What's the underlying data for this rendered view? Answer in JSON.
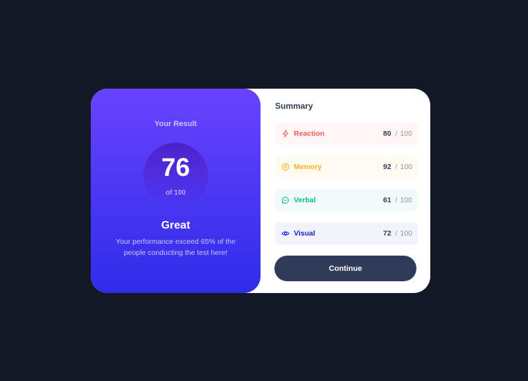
{
  "result": {
    "heading": "Your Result",
    "score": "76",
    "score_of": "of 100",
    "grade": "Great",
    "description": "Your performance exceed 65% of the people conducting the test here!"
  },
  "summary": {
    "title": "Summary",
    "items": [
      {
        "label": "Reaction",
        "score": "80",
        "separator": "/",
        "max": "100",
        "icon": "lightning-icon",
        "color": "#ff5757",
        "bg": "#fff6f5"
      },
      {
        "label": "Memory",
        "score": "92",
        "separator": "/",
        "max": "100",
        "icon": "brain-icon",
        "color": "#ffb01f",
        "bg": "#fffbf2"
      },
      {
        "label": "Verbal",
        "score": "61",
        "separator": "/",
        "max": "100",
        "icon": "chat-icon",
        "color": "#00bb8f",
        "bg": "#f2fbfa"
      },
      {
        "label": "Visual",
        "score": "72",
        "separator": "/",
        "max": "100",
        "icon": "eye-icon",
        "color": "#1125d6",
        "bg": "#f3f3fd"
      }
    ],
    "continue_label": "Continue"
  }
}
